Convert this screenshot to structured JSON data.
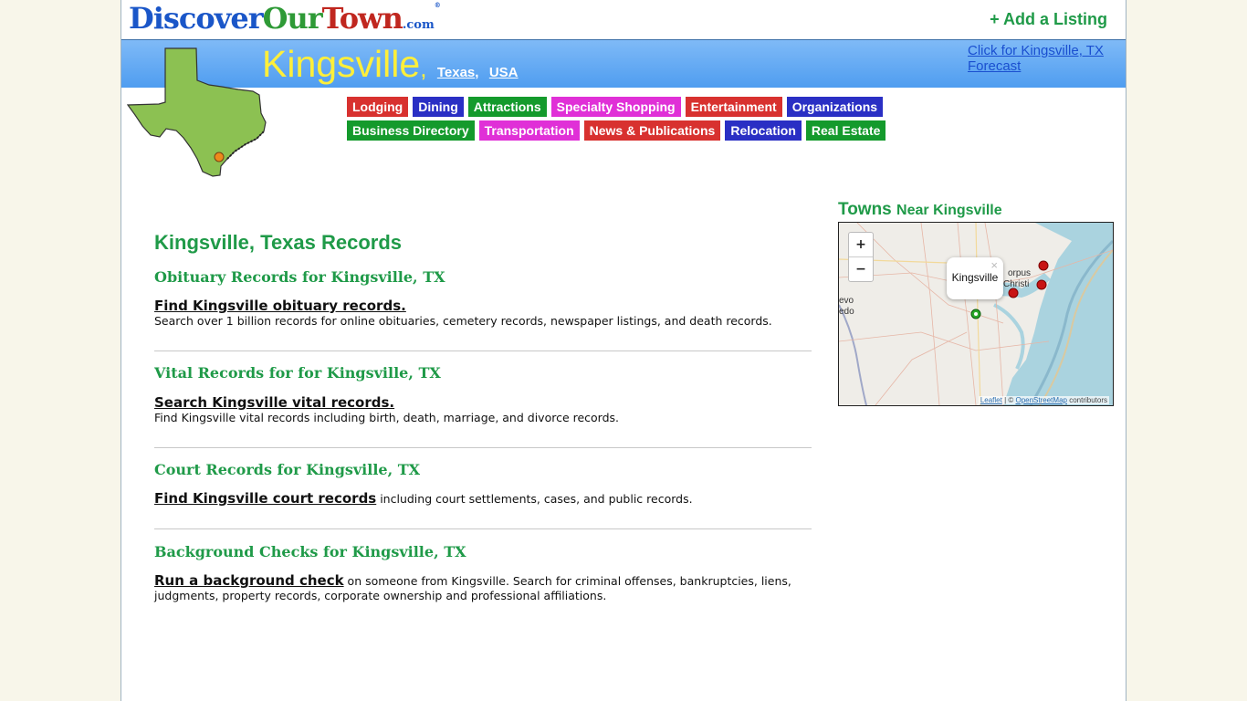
{
  "logo": {
    "part1": "Discover",
    "part2": "Our",
    "part3": "Town",
    "part4": ".com",
    "reg": "®"
  },
  "header": {
    "add_listing": "+ Add a Listing"
  },
  "banner": {
    "city": "Kingsville",
    "comma": ",",
    "state_link": "Texas",
    "country_link": "USA",
    "forecast": "Click for Kingsville, TX Forecast"
  },
  "nav": {
    "row1": [
      {
        "label": "Lodging",
        "color": "#d8312f"
      },
      {
        "label": "Dining",
        "color": "#2a2fc4"
      },
      {
        "label": "Attractions",
        "color": "#149a2c"
      },
      {
        "label": "Specialty Shopping",
        "color": "#e030d7"
      },
      {
        "label": "Entertainment",
        "color": "#d8312f"
      },
      {
        "label": "Organizations",
        "color": "#2a2fc4"
      }
    ],
    "row2": [
      {
        "label": "Business Directory",
        "color": "#149a2c"
      },
      {
        "label": "Transportation",
        "color": "#e030d7"
      },
      {
        "label": "News & Publications",
        "color": "#d8312f"
      },
      {
        "label": "Relocation",
        "color": "#2a2fc4"
      },
      {
        "label": "Real Estate",
        "color": "#149a2c"
      }
    ]
  },
  "main": {
    "title": "Kingsville, Texas Records",
    "sections": [
      {
        "heading": "Obituary Records for Kingsville, TX",
        "link": "Find Kingsville obituary records.",
        "text": "Search over 1 billion records for online obituaries, cemetery records, newspaper listings, and death records."
      },
      {
        "heading": "Vital Records for for Kingsville, TX",
        "link": "Search Kingsville vital records.",
        "text": "Find Kingsville vital records including birth, death, marriage, and divorce records."
      },
      {
        "heading": "Court Records for Kingsville, TX",
        "link": "Find Kingsville court records",
        "text": " including court settlements, cases, and public records."
      },
      {
        "heading": "Background Checks for Kingsville, TX",
        "link": "Run a background check",
        "text": " on someone from Kingsville. Search for criminal offenses, bankruptcies, liens, judgments, property records, corporate ownership and professional affiliations."
      }
    ]
  },
  "sidebar": {
    "towns_title": "Towns",
    "towns_sub": "Near Kingsville",
    "map": {
      "zoom_in": "+",
      "zoom_out": "−",
      "popup_text": "Kingsville",
      "popup_close": "×",
      "label_corpus": "orpus",
      "label_christi": "Christi",
      "label_left1": "evo",
      "label_left2": "edo",
      "attrib_leaflet": "Leaflet",
      "attrib_sep": " | © ",
      "attrib_osm": "OpenStreetMap",
      "attrib_tail": " contributors"
    }
  }
}
